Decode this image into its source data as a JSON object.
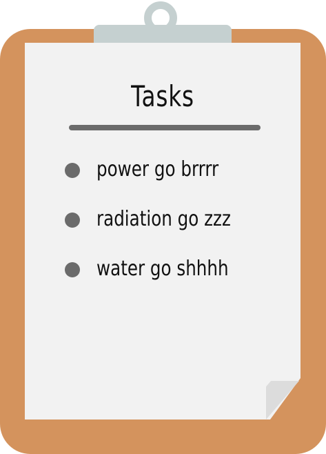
{
  "colors": {
    "board": "#d4935d",
    "clip": "#c5d0d0",
    "paper": "#f2f2f2",
    "fold": "#dcdcdc",
    "text": "#111111",
    "rule": "#6b6b6b",
    "bullet": "#6b6b6b"
  },
  "icons": {
    "clip": "clipboard-clip-icon",
    "bullet": "bullet-dot-icon"
  },
  "card": {
    "title": "Tasks",
    "tasks": [
      {
        "label": "power go brrrr"
      },
      {
        "label": "radiation go zzz"
      },
      {
        "label": "water go shhhh"
      }
    ]
  }
}
